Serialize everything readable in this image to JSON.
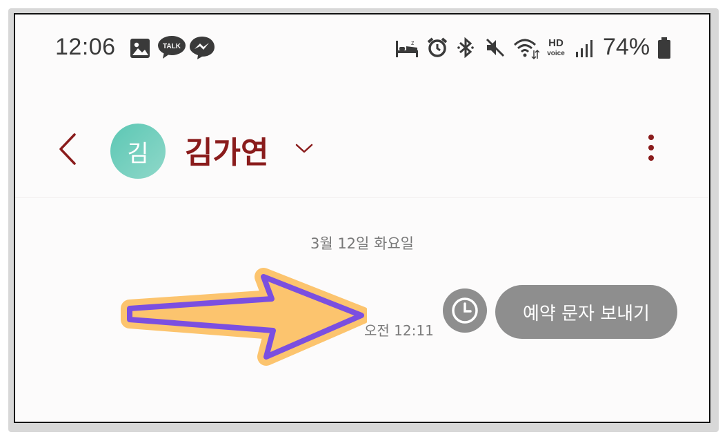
{
  "status_bar": {
    "time": "12:06",
    "left_icons": [
      "gallery-icon",
      "kakaotalk-icon",
      "messenger-icon"
    ],
    "kakao_label": "TALK",
    "right_icons": [
      "sleep-mode-icon",
      "alarm-icon",
      "bluetooth-icon",
      "mute-icon",
      "wifi-icon",
      "hd-voice-icon",
      "signal-icon",
      "battery-icon"
    ],
    "hd_label": "HD",
    "voice_label": "voice",
    "battery": "74%"
  },
  "header": {
    "avatar_initial": "김",
    "contact_name": "김가연"
  },
  "conversation": {
    "date_divider": "3월 12일 화요일",
    "message_time": "오전 12:11",
    "scheduled_button_label": "예약 문자 보내기"
  },
  "colors": {
    "name_color": "#8a1c1c",
    "avatar_color": "#5cc7b4",
    "bubble_color": "#8e8e8e",
    "arrow_fill": "#fcc46e",
    "arrow_outline": "#7b4fe0"
  }
}
